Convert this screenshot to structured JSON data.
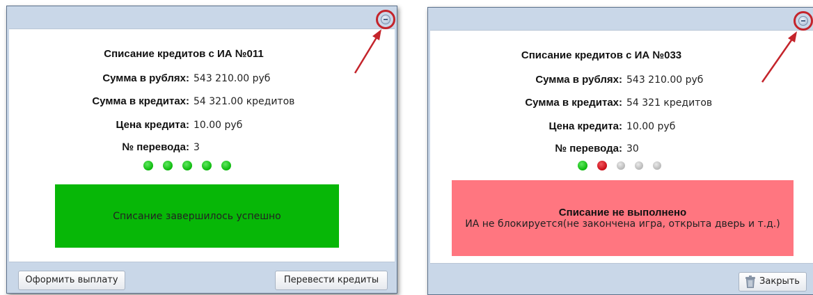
{
  "panels": [
    {
      "title": "Списание кредитов с ИА №011",
      "rows": [
        {
          "label": "Сумма в рублях:",
          "value": "543 210.00 руб"
        },
        {
          "label": "Сумма в кредитах:",
          "value": "54 321.00 кредитов"
        },
        {
          "label": "Цена кредита:",
          "value": "10.00 руб"
        },
        {
          "label": "№ перевода:",
          "value": "3"
        }
      ],
      "progress_dots": [
        "green",
        "green",
        "green",
        "green",
        "green"
      ],
      "status": {
        "heading": "",
        "message": "Списание завершилось успешно",
        "color": "#07b707"
      },
      "buttons": {
        "left": "Оформить выплату",
        "right": "Перевести кредиты"
      }
    },
    {
      "title": "Списание кредитов с ИА №033",
      "rows": [
        {
          "label": "Сумма в рублях:",
          "value": "543 210.00 руб"
        },
        {
          "label": "Сумма в кредитах:",
          "value": "54 321 кредитов"
        },
        {
          "label": "Цена кредита:",
          "value": "10.00 руб"
        },
        {
          "label": "№ перевода:",
          "value": "30"
        }
      ],
      "progress_dots": [
        "green",
        "red",
        "gray",
        "gray",
        "gray"
      ],
      "status": {
        "heading": "Списание не выполнено",
        "message": "ИА не блокируется(не закончена игра, открыта дверь и т.д.)",
        "color": "#ff7680"
      },
      "buttons": {
        "close": "Закрыть"
      }
    }
  ],
  "icons": {
    "collapse": "minus-circle-icon",
    "close": "trash-icon",
    "annotation": "red-arrow-icon"
  },
  "colors": {
    "panel_bg": "#c9d7e8",
    "success": "#07b707",
    "error": "#ff7680",
    "annotation": "#c4242b"
  }
}
